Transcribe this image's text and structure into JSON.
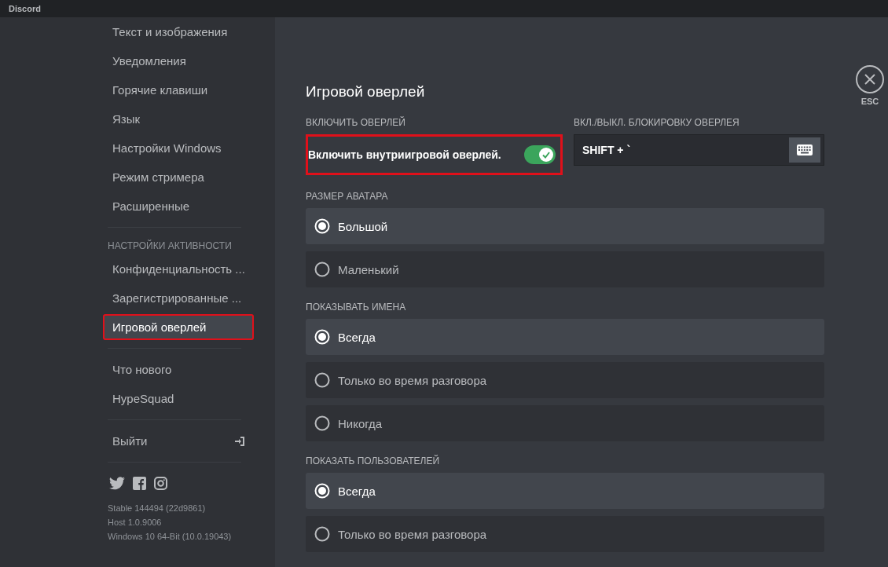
{
  "window": {
    "title": "Discord"
  },
  "sidebar": {
    "items": [
      {
        "kind": "item",
        "label": "Текст и изображения",
        "selected": false,
        "highlighted": false
      },
      {
        "kind": "item",
        "label": "Уведомления",
        "selected": false,
        "highlighted": false
      },
      {
        "kind": "item",
        "label": "Горячие клавиши",
        "selected": false,
        "highlighted": false
      },
      {
        "kind": "item",
        "label": "Язык",
        "selected": false,
        "highlighted": false
      },
      {
        "kind": "item",
        "label": "Настройки Windows",
        "selected": false,
        "highlighted": false
      },
      {
        "kind": "item",
        "label": "Режим стримера",
        "selected": false,
        "highlighted": false
      },
      {
        "kind": "item",
        "label": "Расширенные",
        "selected": false,
        "highlighted": false
      },
      {
        "kind": "divider"
      },
      {
        "kind": "header",
        "label": "НАСТРОЙКИ АКТИВНОСТИ"
      },
      {
        "kind": "item",
        "label": "Конфиденциальность ...",
        "selected": false,
        "highlighted": false
      },
      {
        "kind": "item",
        "label": "Зарегистрированные ...",
        "selected": false,
        "highlighted": false
      },
      {
        "kind": "item",
        "label": "Игровой оверлей",
        "selected": true,
        "highlighted": true
      },
      {
        "kind": "divider"
      },
      {
        "kind": "item",
        "label": "Что нового",
        "selected": false,
        "highlighted": false
      },
      {
        "kind": "item",
        "label": "HypeSquad",
        "selected": false,
        "highlighted": false
      },
      {
        "kind": "divider"
      },
      {
        "kind": "logout",
        "label": "Выйти",
        "selected": false,
        "highlighted": false
      },
      {
        "kind": "divider"
      }
    ],
    "version": [
      "Stable 144494 (22d9861)",
      "Host 1.0.9006",
      "Windows 10 64-Bit (10.0.19043)"
    ]
  },
  "content": {
    "title": "Игровой оверлей",
    "overlay": {
      "label": "ВКЛЮЧИТЬ ОВЕРЛЕЙ",
      "toggle_label": "Включить внутриигровой оверлей.",
      "on": true,
      "highlighted": true
    },
    "keybind": {
      "label": "ВКЛ./ВЫКЛ. БЛОКИРОВКУ ОВЕРЛЕЯ",
      "value": "SHIFT + `"
    },
    "groups": [
      {
        "label": "РАЗМЕР АВАТАРА",
        "options": [
          {
            "label": "Большой",
            "selected": true
          },
          {
            "label": "Маленький",
            "selected": false
          }
        ]
      },
      {
        "label": "ПОКАЗЫВАТЬ ИМЕНА",
        "options": [
          {
            "label": "Всегда",
            "selected": true
          },
          {
            "label": "Только во время разговора",
            "selected": false
          },
          {
            "label": "Никогда",
            "selected": false
          }
        ]
      },
      {
        "label": "ПОКАЗАТЬ ПОЛЬЗОВАТЕЛЕЙ",
        "options": [
          {
            "label": "Всегда",
            "selected": true
          },
          {
            "label": "Только во время разговора",
            "selected": false
          }
        ]
      }
    ]
  },
  "close": {
    "label": "ESC"
  }
}
